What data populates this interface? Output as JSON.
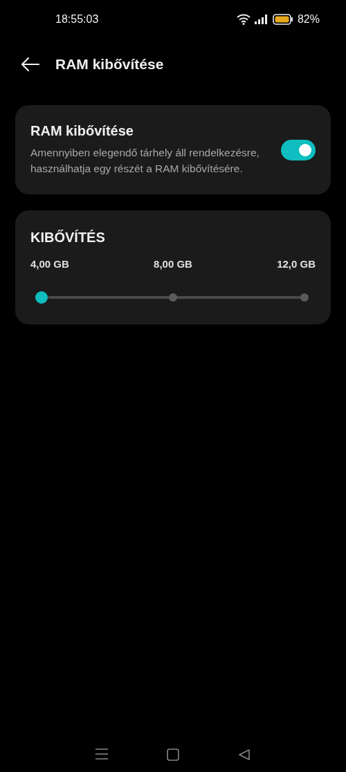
{
  "status_bar": {
    "time": "18:55:03",
    "battery": "82%"
  },
  "header": {
    "title": "RAM kibővítése"
  },
  "toggle_card": {
    "title": "RAM kibővítése",
    "description": "Amennyiben elegendő tárhely áll rendelkezésre, használhatja egy részét a RAM kibővítésére.",
    "on": true
  },
  "expansion": {
    "title": "KIBŐVÍTÉS",
    "level": 0,
    "stops": [
      {
        "label": "4,00 GB"
      },
      {
        "label": "8,00 GB"
      },
      {
        "label": "12,0 GB"
      }
    ]
  }
}
